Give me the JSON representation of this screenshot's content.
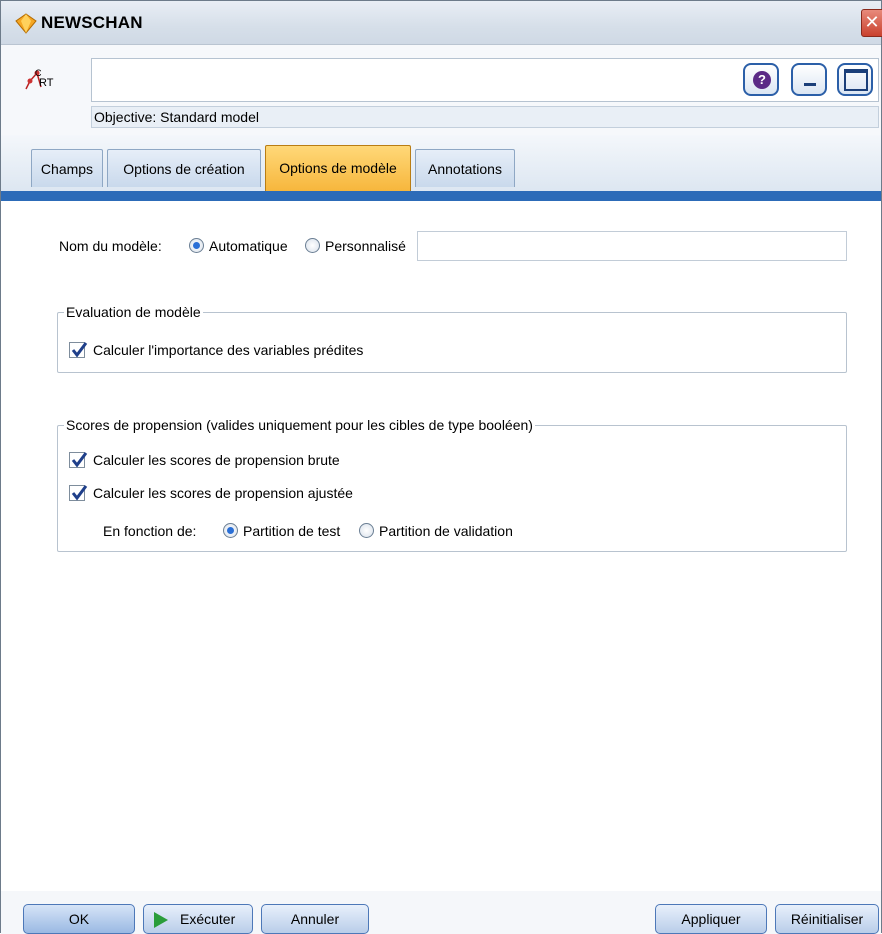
{
  "window": {
    "title": "NEWSCHAN"
  },
  "header": {
    "objective": "Objective: Standard model",
    "help_icon": "help-icon",
    "minimize_icon": "minimize-icon",
    "maximize_icon": "maximize-icon"
  },
  "tabs": [
    {
      "label": "Champs"
    },
    {
      "label": "Options de création"
    },
    {
      "label": "Options de modèle"
    },
    {
      "label": "Annotations"
    }
  ],
  "model_name": {
    "label": "Nom du modèle:",
    "options": [
      "Automatique",
      "Personnalisé"
    ],
    "selected": "Automatique",
    "value": ""
  },
  "evaluation": {
    "title": "Evaluation de modèle",
    "importance_label": "Calculer l'importance des variables prédites",
    "importance_checked": true
  },
  "propensity": {
    "title": "Scores de propension (valides uniquement pour les cibles de type booléen)",
    "raw_label": "Calculer les scores de propension brute",
    "raw_checked": true,
    "adjusted_label": "Calculer les scores de propension ajustée",
    "adjusted_checked": true,
    "based_on_label": "En fonction de:",
    "partition_options": [
      "Partition de test",
      "Partition de validation"
    ],
    "selected_partition": "Partition de test"
  },
  "footer": {
    "ok": "OK",
    "run": "Exécuter",
    "cancel": "Annuler",
    "apply": "Appliquer",
    "reset": "Réinitialiser"
  },
  "colors": {
    "accent": "#2c6bb8",
    "active_tab": "#f6b53a",
    "close_button": "#c9412d"
  }
}
